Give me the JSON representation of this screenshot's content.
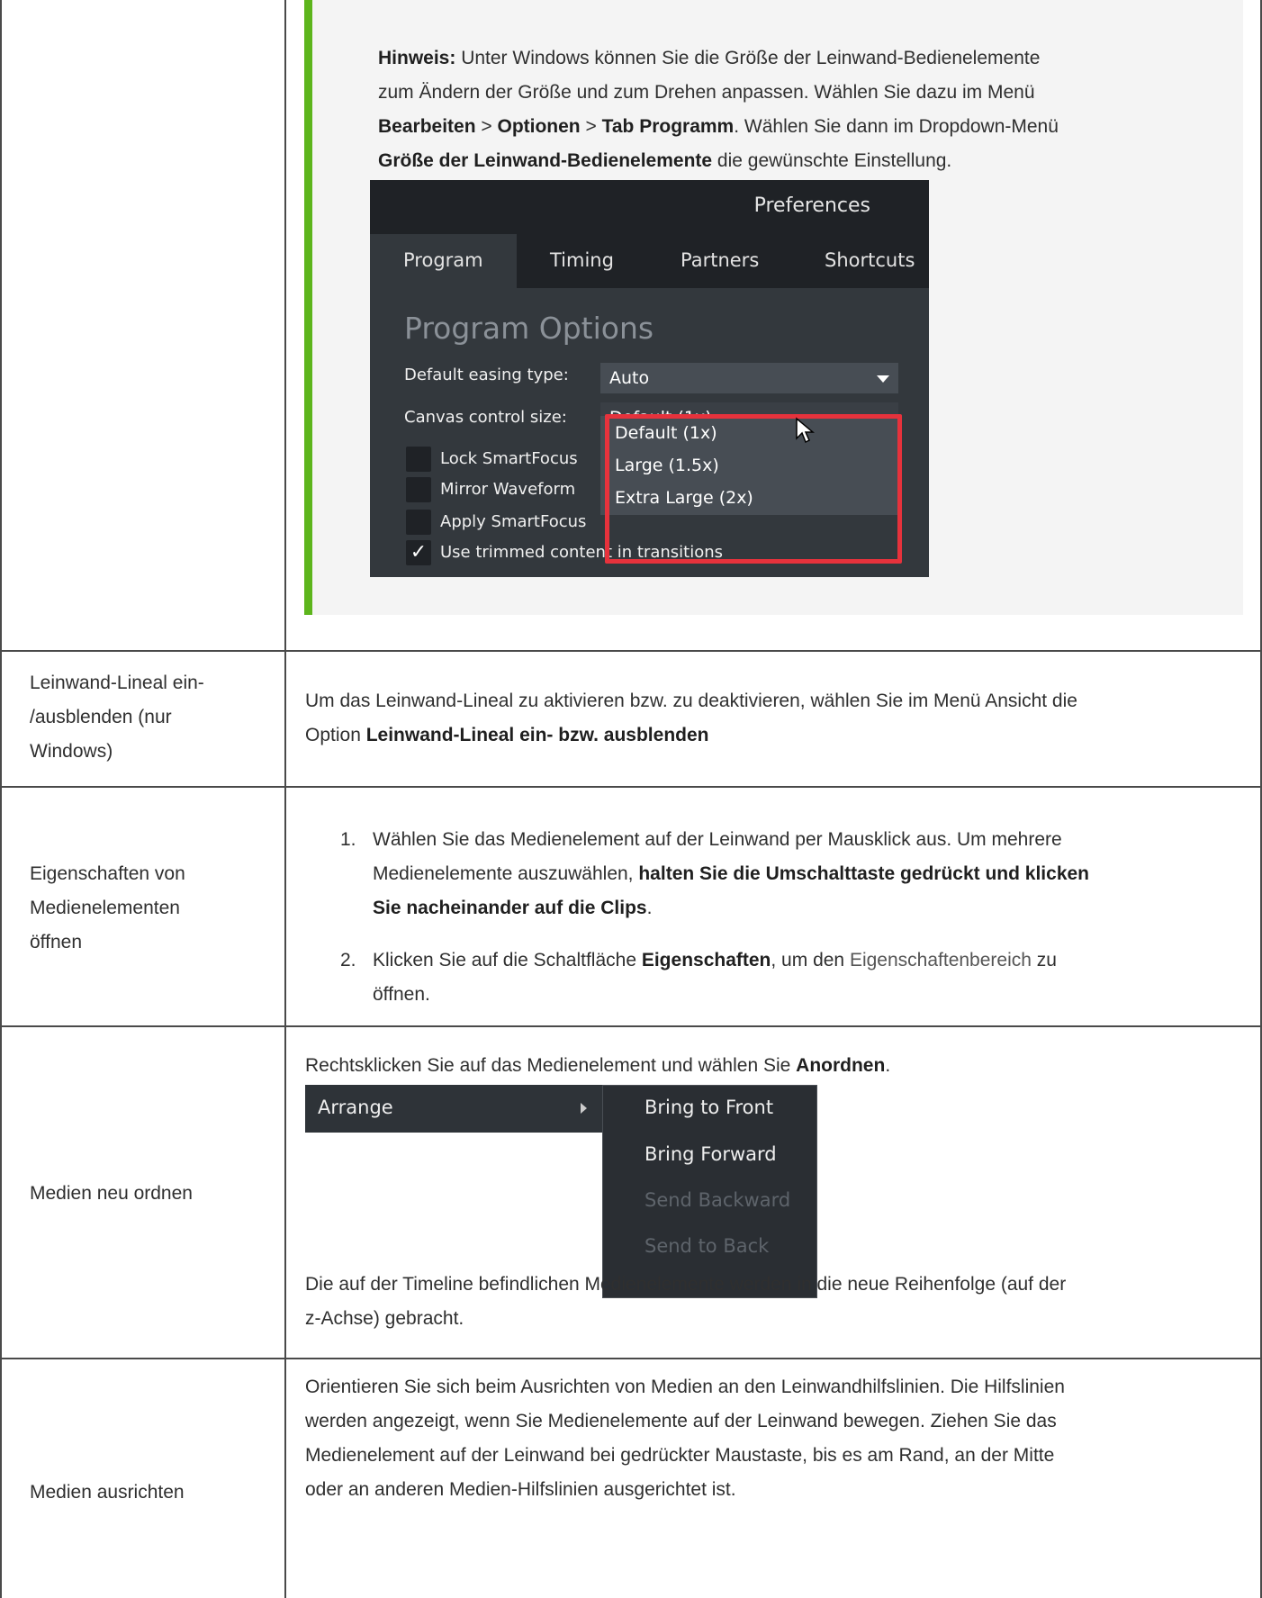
{
  "note": {
    "prefix": "Hinweis:",
    "line1_rest": " Unter Windows können Sie die Größe der Leinwand-Bedienelemente",
    "line2": "zum Ändern der Größe und zum Drehen anpassen. Wählen Sie dazu im Menü",
    "menu_path_1": "Bearbeiten",
    "sep": " > ",
    "menu_path_2": "Optionen",
    "menu_path_3": "Tab Programm",
    "line3_rest": ". Wählen Sie dann im Dropdown-Menü",
    "dropdown_name": "Größe der Leinwand-Bedienelemente",
    "line4_rest": " die gewünschte Einstellung."
  },
  "prefs": {
    "title": "Preferences",
    "tabs": [
      "Program",
      "Timing",
      "Partners",
      "Shortcuts"
    ],
    "heading": "Program Options",
    "easing_label": "Default easing type:",
    "easing_value": "Auto",
    "canvas_label": "Canvas control size:",
    "canvas_value": "Default (1x)",
    "checkboxes": [
      "Lock SmartFocus",
      "Mirror Waveform",
      "Apply SmartFocus",
      "Use trimmed content in transitions"
    ],
    "checkbox_checked": [
      false,
      false,
      false,
      true
    ],
    "options": [
      "Default (1x)",
      "Large (1.5x)",
      "Extra Large (2x)"
    ]
  },
  "rows": {
    "ruler": {
      "label": [
        "Leinwand-Lineal ein-",
        "/ausblenden (nur",
        "Windows)"
      ],
      "text1": "Um das Leinwand-Lineal zu aktivieren bzw. zu deaktivieren, wählen Sie im Menü Ansicht die",
      "text2_prefix": "Option ",
      "text2_bold": "Leinwand-Lineal ein- bzw. ausblenden"
    },
    "properties": {
      "label": [
        "Eigenschaften von",
        "Medienelementen",
        "öffnen"
      ],
      "step1_num": "1.",
      "step1_line1": "Wählen Sie das Medienelement auf der Leinwand per Mausklick aus. Um mehrere",
      "step1_line2_plain": "Medienelemente auszuwählen, ",
      "step1_line2_bold": "halten Sie die Umschalttaste gedrückt und klicken",
      "step1_line3_bold": "Sie nacheinander auf die Clips",
      "step1_line3_end": ".",
      "step2_num": "2.",
      "step2_plain1": "Klicken Sie auf die Schaltfläche ",
      "step2_bold": "Eigenschaften",
      "step2_plain2": ", um den ",
      "step2_link": "Eigenschaftenbereich",
      "step2_plain3": " zu",
      "step2_line2": "öffnen."
    },
    "arrange": {
      "label": "Medien neu ordnen",
      "intro_plain": "Rechtsklicken Sie auf das Medienelement und wählen Sie ",
      "intro_bold": "Anordnen",
      "intro_end": ".",
      "menu_label": "Arrange",
      "submenu": [
        {
          "label": "Bring to Front",
          "enabled": true
        },
        {
          "label": "Bring Forward",
          "enabled": true
        },
        {
          "label": "Send Backward",
          "enabled": false
        },
        {
          "label": "Send to Back",
          "enabled": false
        }
      ],
      "outro1": "Die auf der Timeline befindlichen Medienelemente werden in die neue Reihenfolge (auf der",
      "outro2": "z-Achse) gebracht."
    },
    "align": {
      "label": "Medien ausrichten",
      "lines": [
        "Orientieren Sie sich beim Ausrichten von Medien an den Leinwandhilfslinien. Die Hilfslinien",
        "werden angezeigt, wenn Sie Medienelemente auf der Leinwand bewegen. Ziehen Sie das",
        "Medienelement auf der Leinwand bei gedrückter Maustaste, bis es am Rand, an der Mitte",
        "oder an anderen Medien-Hilfslinien ausgerichtet ist."
      ]
    }
  }
}
